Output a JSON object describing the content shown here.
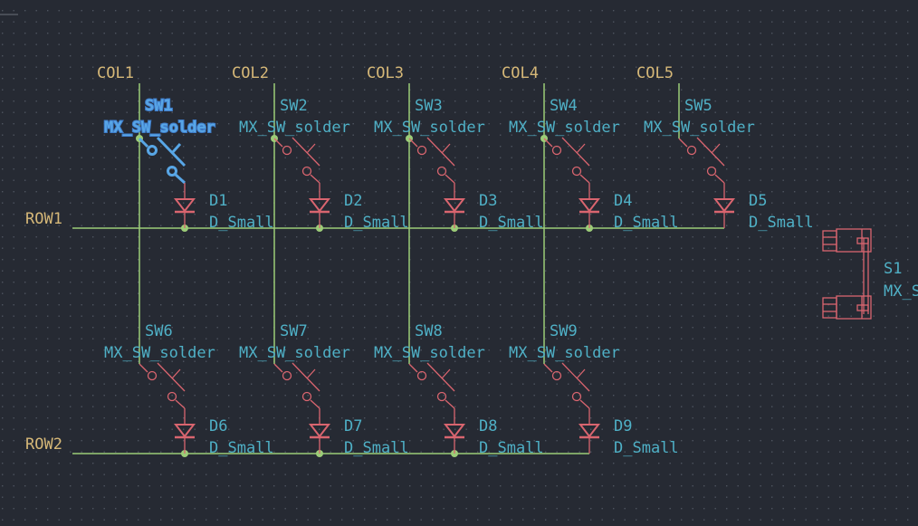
{
  "app": "schematic-editor",
  "colors": {
    "background": "#262a33",
    "grid": "#4e545f",
    "wire": "#9ccc78",
    "junction": "#9ccc78",
    "symbol": "#d9656f",
    "net_label": "#d6b878",
    "reference": "#4fb0c6",
    "selection": "#58a6e6"
  },
  "columns": [
    {
      "net": "COL1"
    },
    {
      "net": "COL2"
    },
    {
      "net": "COL3"
    },
    {
      "net": "COL4"
    },
    {
      "net": "COL5"
    }
  ],
  "rows": [
    {
      "net": "ROW1"
    },
    {
      "net": "ROW2"
    }
  ],
  "switches": [
    {
      "ref": "SW1",
      "value": "MX_SW_solder",
      "row": 0,
      "col": 0,
      "selected": true
    },
    {
      "ref": "SW2",
      "value": "MX_SW_solder",
      "row": 0,
      "col": 1,
      "selected": false
    },
    {
      "ref": "SW3",
      "value": "MX_SW_solder",
      "row": 0,
      "col": 2,
      "selected": false
    },
    {
      "ref": "SW4",
      "value": "MX_SW_solder",
      "row": 0,
      "col": 3,
      "selected": false
    },
    {
      "ref": "SW5",
      "value": "MX_SW_solder",
      "row": 0,
      "col": 4,
      "selected": false
    },
    {
      "ref": "SW6",
      "value": "MX_SW_solder",
      "row": 1,
      "col": 0,
      "selected": false
    },
    {
      "ref": "SW7",
      "value": "MX_SW_solder",
      "row": 1,
      "col": 1,
      "selected": false
    },
    {
      "ref": "SW8",
      "value": "MX_SW_solder",
      "row": 1,
      "col": 2,
      "selected": false
    },
    {
      "ref": "SW9",
      "value": "MX_SW_solder",
      "row": 1,
      "col": 3,
      "selected": false
    }
  ],
  "diodes": [
    {
      "ref": "D1",
      "value": "D_Small"
    },
    {
      "ref": "D2",
      "value": "D_Small"
    },
    {
      "ref": "D3",
      "value": "D_Small"
    },
    {
      "ref": "D4",
      "value": "D_Small"
    },
    {
      "ref": "D5",
      "value": "D_Small"
    },
    {
      "ref": "D6",
      "value": "D_Small"
    },
    {
      "ref": "D7",
      "value": "D_Small"
    },
    {
      "ref": "D8",
      "value": "D_Small"
    },
    {
      "ref": "D9",
      "value": "D_Small"
    }
  ],
  "connector": {
    "ref": "S1",
    "value": "MX_S"
  }
}
